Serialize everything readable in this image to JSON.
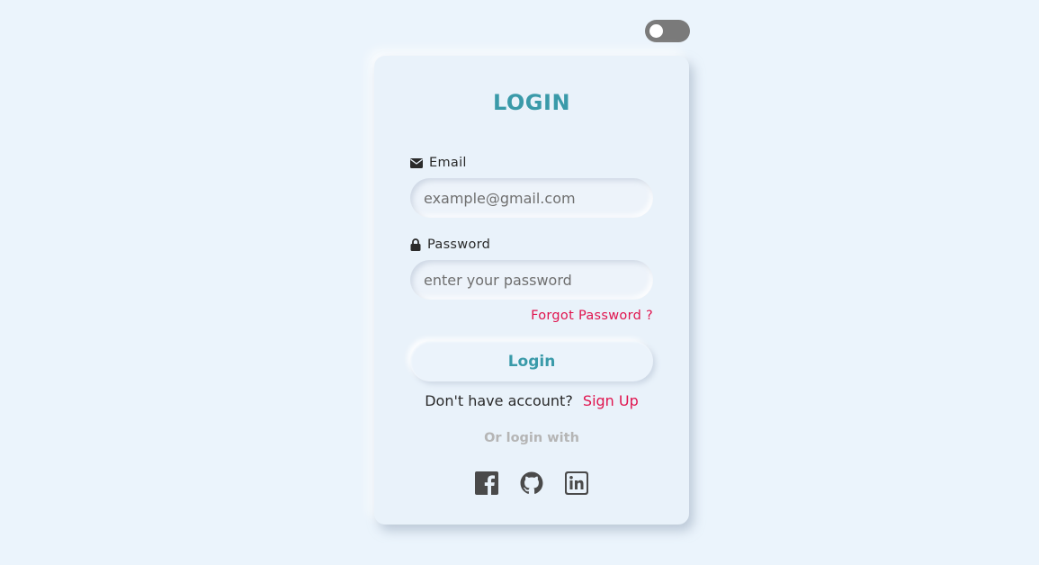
{
  "theme": {
    "accent": "#3a9aa9",
    "link": "#e0144e",
    "background": "#ebf4fc",
    "toggle": "#7a7a7a"
  },
  "theme_toggle": {
    "state": "off"
  },
  "login_card": {
    "title": "LOGIN",
    "email": {
      "label": "Email",
      "icon": "envelope-icon",
      "placeholder": "example@gmail.com",
      "value": ""
    },
    "password": {
      "label": "Password",
      "icon": "lock-icon",
      "placeholder": "enter your password",
      "value": ""
    },
    "forgot_password": "Forgot Password ?",
    "login_button": "Login",
    "signup_prompt": "Don't have account?",
    "signup_link": "Sign Up",
    "or_login_with": "Or login with",
    "social_icons": [
      "facebook-icon",
      "github-icon",
      "linkedin-icon"
    ]
  }
}
